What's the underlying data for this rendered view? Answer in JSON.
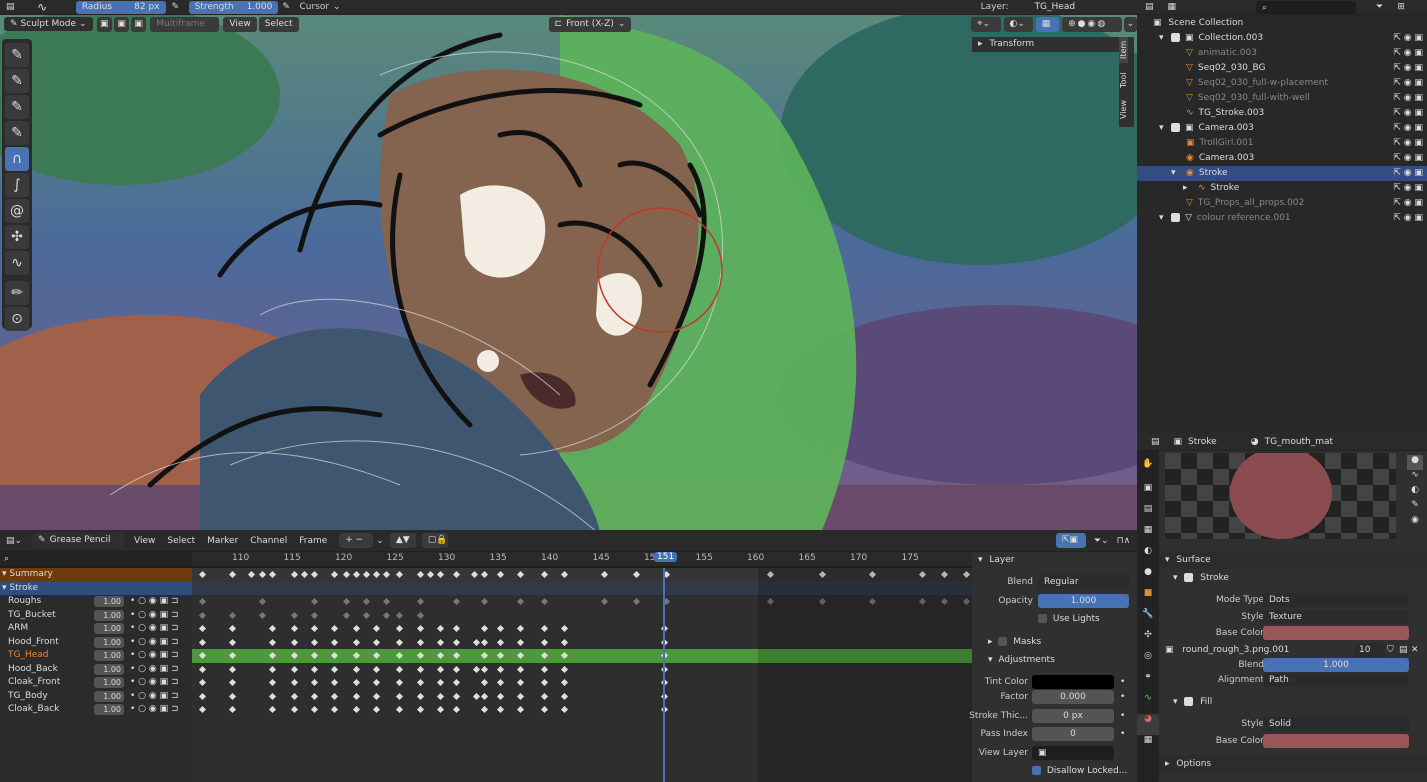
{
  "top_toolbar": {
    "radius_label": "Radius",
    "radius_value": "82 px",
    "strength_label": "Strength",
    "strength_value": "1.000",
    "cursor_label": "Cursor",
    "layer_label": "Layer:",
    "layer_value": "TG_Head"
  },
  "viewport_header": {
    "mode": "Sculpt Mode",
    "multiframe": "Multiframe",
    "view": "View",
    "select": "Select",
    "view_name": "Front (X-Z)"
  },
  "sidebar": {
    "transform": "Transform",
    "tabs": [
      "Item",
      "Tool",
      "View"
    ]
  },
  "outliner": {
    "title": "Scene Collection",
    "rows": [
      {
        "label": "Collection.003",
        "indent": 1,
        "sel": false,
        "dim": false
      },
      {
        "label": "animatic.003",
        "indent": 2,
        "sel": false,
        "dim": true
      },
      {
        "label": "Seq02_030_BG",
        "indent": 2,
        "sel": false,
        "dim": false
      },
      {
        "label": "Seq02_030_full-w-placement",
        "indent": 2,
        "sel": false,
        "dim": true
      },
      {
        "label": "Seq02_030_full-with-well",
        "indent": 2,
        "sel": false,
        "dim": true
      },
      {
        "label": "TG_Stroke.003",
        "indent": 2,
        "sel": false,
        "dim": false
      },
      {
        "label": "Camera.003",
        "indent": 1,
        "sel": false,
        "dim": false
      },
      {
        "label": "TrollGirl.001",
        "indent": 2,
        "sel": false,
        "dim": true
      },
      {
        "label": "Camera.003",
        "indent": 2,
        "sel": false,
        "dim": false
      },
      {
        "label": "Stroke",
        "indent": 2,
        "sel": true,
        "dim": false
      },
      {
        "label": "Stroke",
        "indent": 3,
        "sel": false,
        "dim": false
      },
      {
        "label": "TG_Props_all_props.002",
        "indent": 2,
        "sel": false,
        "dim": true
      },
      {
        "label": "colour reference.001",
        "indent": 1,
        "sel": false,
        "dim": true
      }
    ]
  },
  "properties": {
    "object": "Stroke",
    "material": "TG_mouth_mat",
    "surface": "Surface",
    "stroke": "Stroke",
    "mode_type_label": "Mode Type",
    "mode_type": "Dots",
    "style_label": "Style",
    "style": "Texture",
    "base_color_label": "Base Color",
    "texture": "round_rough_3.png.001",
    "texture_users": "10",
    "blend_label": "Blend",
    "blend_value": "1.000",
    "alignment_label": "Alignment",
    "alignment": "Path",
    "fill": "Fill",
    "fill_style": "Solid",
    "options": "Options",
    "colors": {
      "base": "#9c5658"
    }
  },
  "dopesheet": {
    "editor": "Grease Pencil",
    "menus": [
      "View",
      "Select",
      "Marker",
      "Channel",
      "Frame"
    ],
    "frames": [
      "110",
      "115",
      "120",
      "125",
      "130",
      "135",
      "140",
      "145",
      "150",
      "155",
      "160",
      "165",
      "170",
      "175"
    ],
    "current_frame": "151",
    "channels": [
      {
        "name": "Summary",
        "value": ""
      },
      {
        "name": "Stroke",
        "value": ""
      },
      {
        "name": "Roughs",
        "value": "1.00"
      },
      {
        "name": "TG_Bucket",
        "value": "1.00"
      },
      {
        "name": "ARM",
        "value": "1.00"
      },
      {
        "name": "Hood_Front",
        "value": "1.00"
      },
      {
        "name": "TG_Head",
        "value": "1.00"
      },
      {
        "name": "Hood_Back",
        "value": "1.00"
      },
      {
        "name": "Cloak_Front",
        "value": "1.00"
      },
      {
        "name": "TG_Body",
        "value": "1.00"
      },
      {
        "name": "Cloak_Back",
        "value": "1.00"
      }
    ]
  },
  "layer_panel": {
    "title": "Layer",
    "blend_label": "Blend",
    "blend": "Regular",
    "opacity_label": "Opacity",
    "opacity": "1.000",
    "use_lights": "Use Lights",
    "masks": "Masks",
    "adjustments": "Adjustments",
    "tint_color": "Tint Color",
    "factor_label": "Factor",
    "factor": "0.000",
    "stroke_thick_label": "Stroke Thic...",
    "stroke_thick": "0 px",
    "pass_index_label": "Pass Index",
    "pass_index": "0",
    "view_layer": "View Layer",
    "disallow": "Disallow Locked..."
  }
}
